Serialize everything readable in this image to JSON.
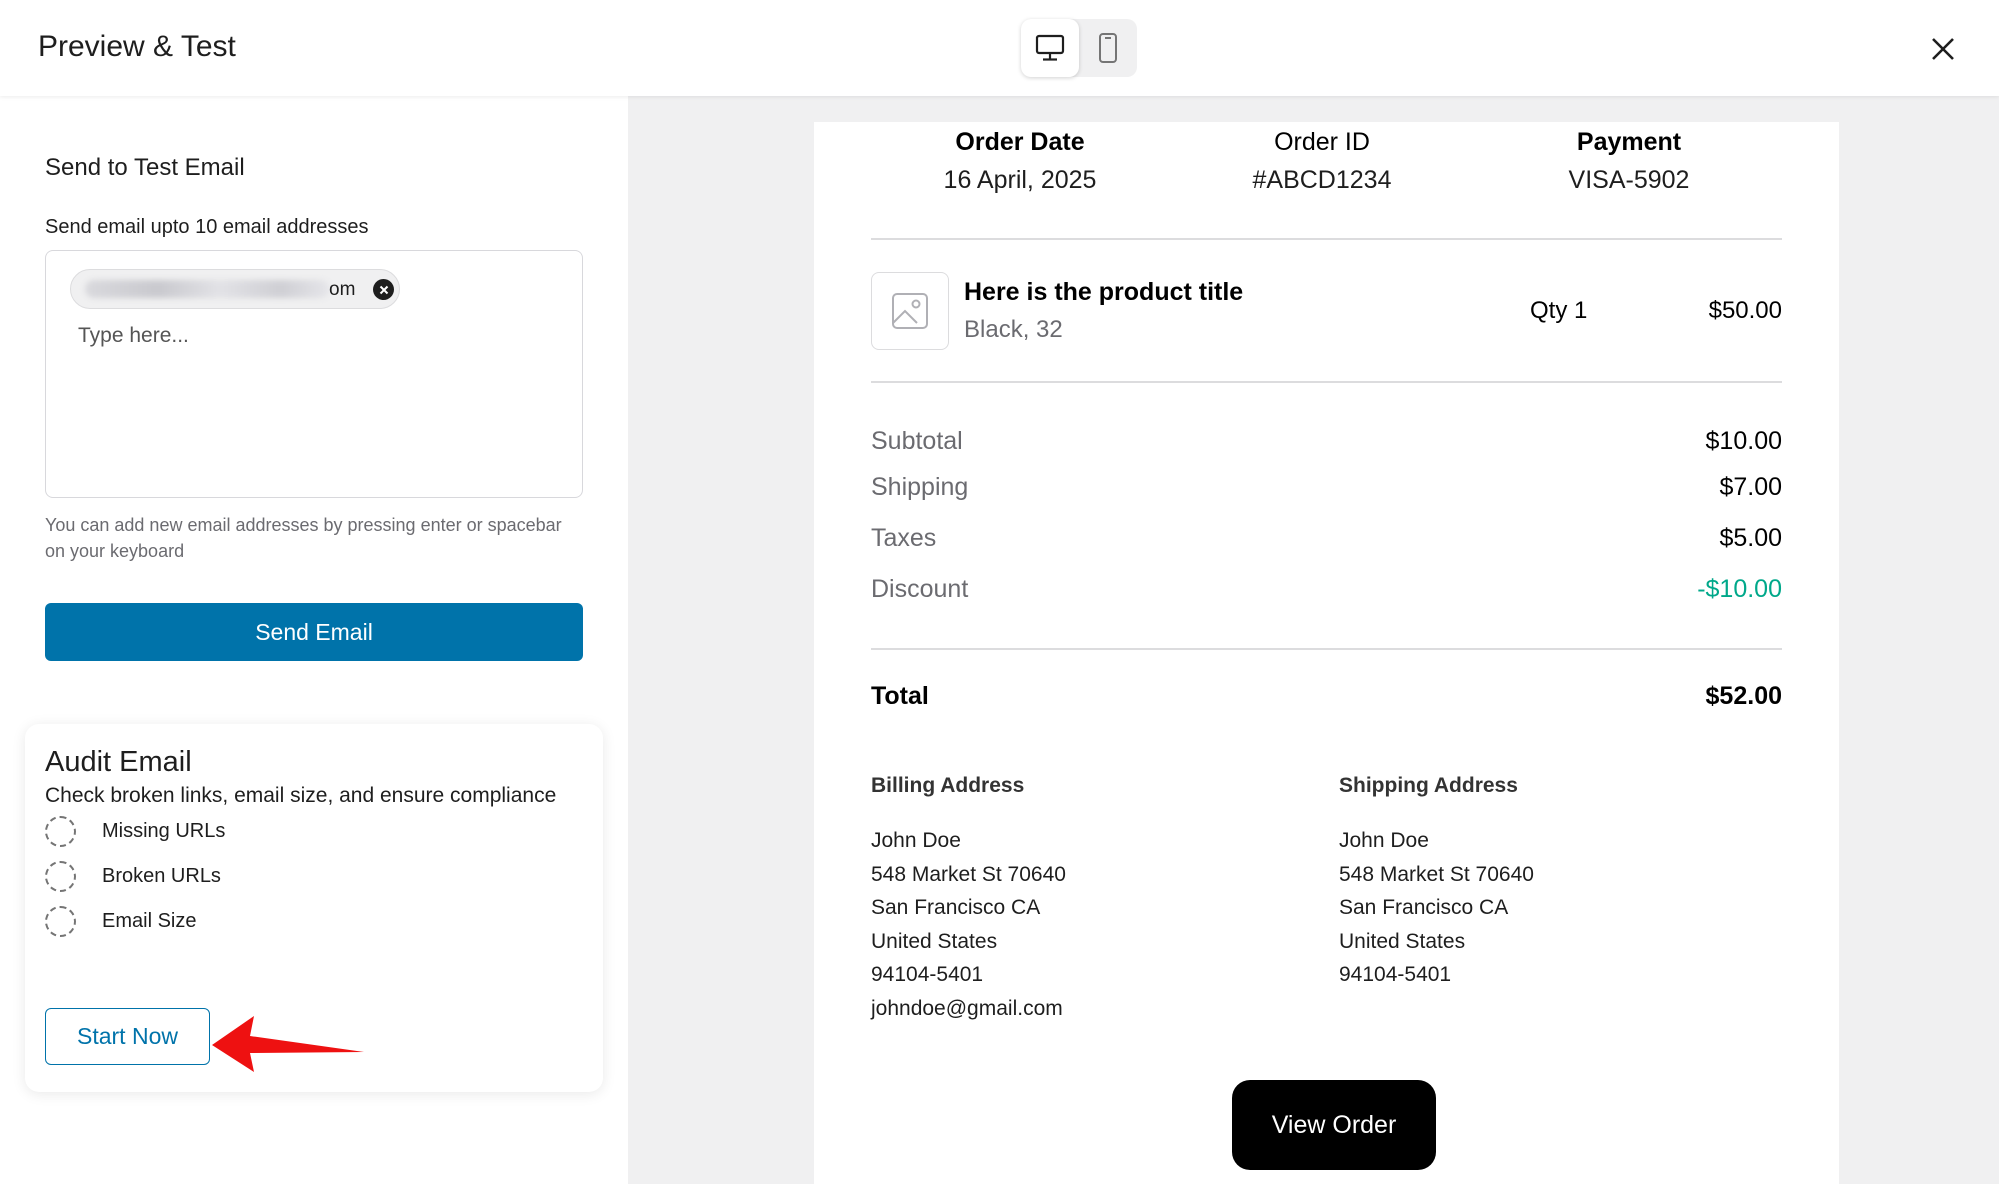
{
  "header": {
    "title": "Preview & Test",
    "desktop_icon": "desktop-icon",
    "mobile_icon": "mobile-icon",
    "close_icon": "close-icon"
  },
  "test_email": {
    "title": "Send to Test Email",
    "field_label": "Send email upto 10 email addresses",
    "chip_suffix": "om",
    "placeholder": "Type here...",
    "help": "You can add new email addresses by pressing enter or spacebar on your keyboard",
    "send_label": "Send Email"
  },
  "audit": {
    "title": "Audit Email",
    "subtitle": "Check broken links, email size, and ensure compliance",
    "items": [
      {
        "label": "Missing URLs"
      },
      {
        "label": "Broken URLs"
      },
      {
        "label": "Email Size"
      }
    ],
    "start_label": "Start Now"
  },
  "preview": {
    "meta": [
      {
        "label": "Order Date",
        "value": "16 April, 2025"
      },
      {
        "label": "Order ID",
        "value": "#ABCD1234"
      },
      {
        "label": "Payment",
        "value": "VISA-5902"
      }
    ],
    "product": {
      "title": "Here is the product title",
      "variant": "Black, 32",
      "qty": "Qty 1",
      "price": "$50.00",
      "image_icon": "image-placeholder-icon"
    },
    "summary": [
      {
        "label": "Subtotal",
        "value": "$10.00"
      },
      {
        "label": "Shipping",
        "value": "$7.00"
      },
      {
        "label": "Taxes",
        "value": "$5.00"
      },
      {
        "label": "Discount",
        "value": "-$10.00"
      }
    ],
    "total": {
      "label": "Total",
      "value": "$52.00"
    },
    "billing": {
      "title": "Billing Address",
      "lines": [
        "John Doe",
        "548 Market St 70640",
        "San Francisco CA",
        "United States",
        "94104-5401",
        "johndoe@gmail.com"
      ]
    },
    "shipping": {
      "title": "Shipping Address",
      "lines": [
        "John Doe",
        "548 Market St 70640",
        "San Francisco CA",
        "United States",
        "94104-5401"
      ]
    },
    "view_order_label": "View Order"
  },
  "colors": {
    "primary": "#0073aa",
    "discount": "#00a88a",
    "annotation_arrow": "#ee1111"
  }
}
